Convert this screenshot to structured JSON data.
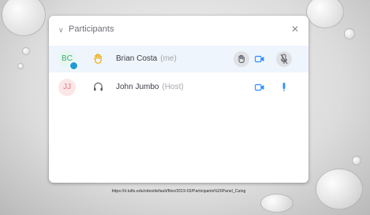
{
  "panel": {
    "title": "Participants",
    "collapse_icon": "chevron-down-icon",
    "close_icon": "close-icon"
  },
  "participants": [
    {
      "initials": "BC",
      "name": "Brian Costa",
      "role": "(me)",
      "status_icon": "hand-icon",
      "controls": [
        "raise-hand-icon",
        "video-camera-icon",
        "muted-microphone-icon"
      ]
    },
    {
      "initials": "JJ",
      "name": "John Jumbo",
      "role": "(Host)",
      "status_icon": "headset-icon",
      "controls": [
        "video-camera-icon",
        "microphone-icon"
      ]
    }
  ],
  "caption": "https://it.tufts.edu/sites/default/files/2019-03/Participants%20Panel_Cuing",
  "colors": {
    "accent": "#2d8cff",
    "selected_row": "#eef5fc",
    "badge": "#1f9cd8",
    "avatar_bc": "#3fa878",
    "avatar_jj": "#e1767c"
  }
}
